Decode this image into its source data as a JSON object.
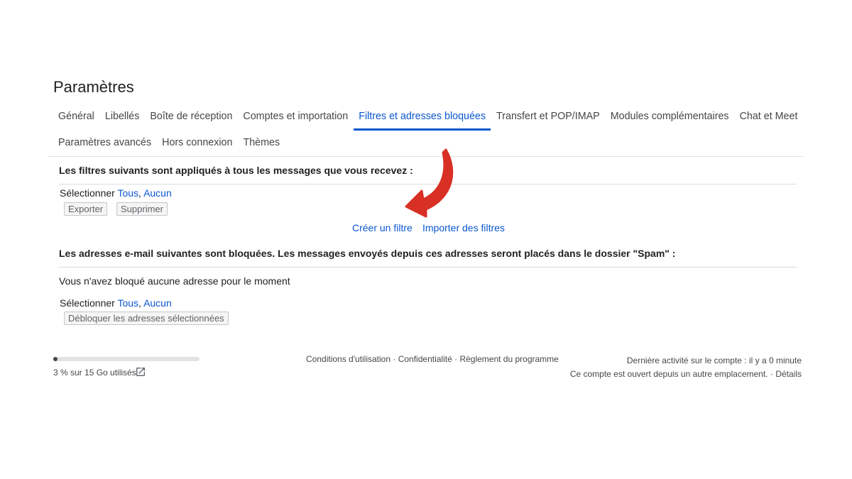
{
  "settings": {
    "title": "Paramètres"
  },
  "tabs": {
    "row1": [
      {
        "label": "Général"
      },
      {
        "label": "Libellés"
      },
      {
        "label": "Boîte de réception"
      },
      {
        "label": "Comptes et importation"
      },
      {
        "label": "Filtres et adresses bloquées",
        "active": true
      },
      {
        "label": "Transfert et POP/IMAP"
      },
      {
        "label": "Modules complémentaires"
      },
      {
        "label": "Chat et Meet"
      }
    ],
    "row2": [
      {
        "label": "Paramètres avancés"
      },
      {
        "label": "Hors connexion"
      },
      {
        "label": "Thèmes"
      }
    ]
  },
  "filters": {
    "heading": "Les filtres suivants sont appliqués à tous les messages que vous recevez :",
    "select_label": "Sélectionner",
    "select_all": "Tous",
    "select_none": "Aucun",
    "export_button": "Exporter",
    "delete_button": "Supprimer",
    "create_filter": "Créer un filtre",
    "import_filters": "Importer des filtres"
  },
  "blocked": {
    "heading": "Les adresses e-mail suivantes sont bloquées. Les messages envoyés depuis ces adresses seront placés dans le dossier \"Spam\" :",
    "empty_text": "Vous n'avez bloqué aucune adresse pour le moment",
    "select_label": "Sélectionner",
    "select_all": "Tous",
    "select_none": "Aucun",
    "unblock_button": "Débloquer les adresses sélectionnées"
  },
  "footer": {
    "storage_text": "3 % sur 15 Go utilisés",
    "storage_fraction": 0.03,
    "terms": "Conditions d'utilisation",
    "privacy": "Confidentialité",
    "program_policies": "Règlement du programme",
    "separator": " · ",
    "last_activity": "Dernière activité sur le compte : il y a 0 minute",
    "open_elsewhere": "Ce compte est ouvert depuis un autre emplacement.",
    "details": "Détails"
  },
  "colors": {
    "accent": "#0b57d0",
    "annotation_arrow": "#d93025"
  },
  "icons": {
    "storage_open": "open-in-new-icon",
    "annotation": "curved-arrow-icon"
  }
}
